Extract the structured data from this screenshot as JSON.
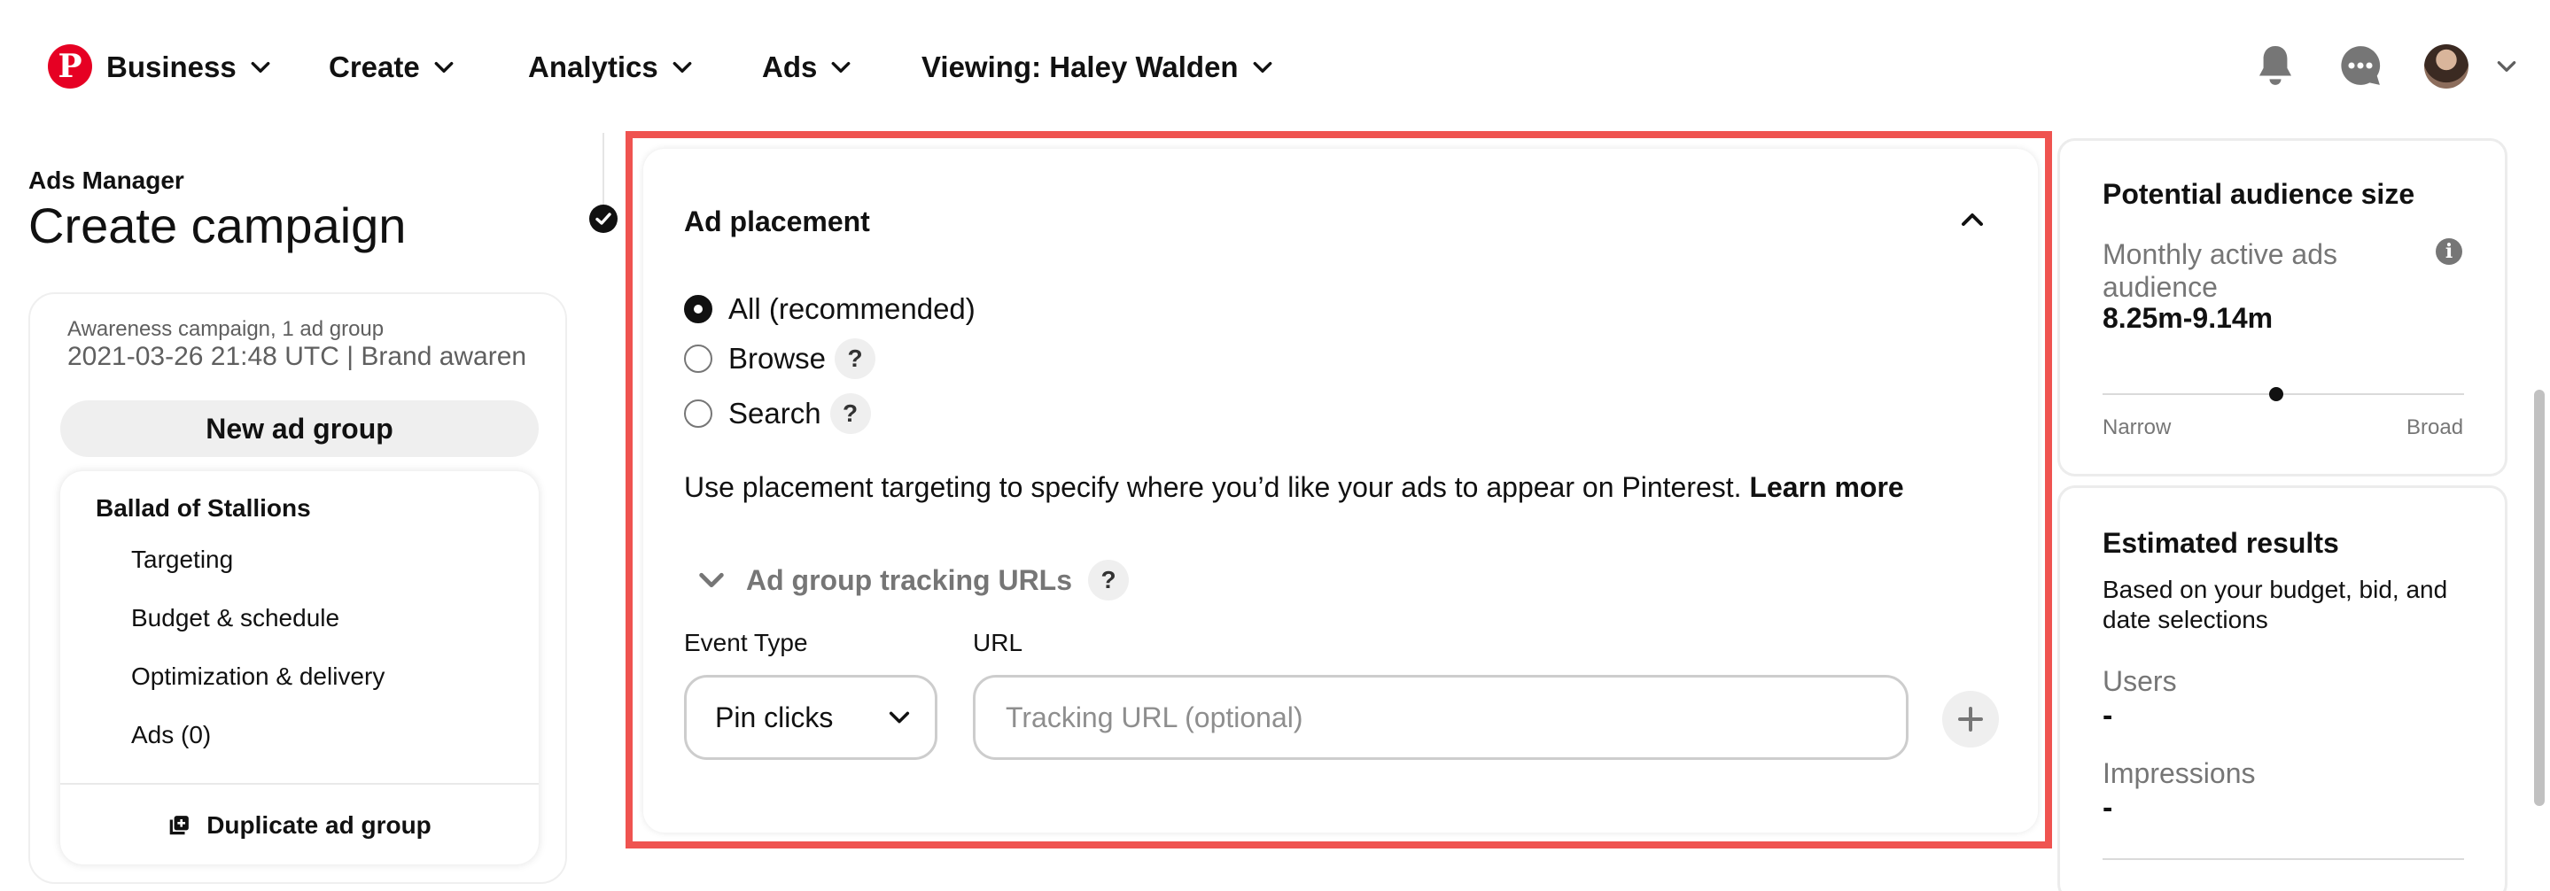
{
  "nav": {
    "logo_letter": "P",
    "business": "Business",
    "create": "Create",
    "analytics": "Analytics",
    "ads": "Ads",
    "viewing": "Viewing: Haley Walden"
  },
  "sidebar": {
    "eyebrow": "Ads Manager",
    "title": "Create campaign",
    "campaign_meta": "Awareness campaign, 1 ad group",
    "campaign_desc": "2021-03-26 21:48 UTC | Brand awaren...",
    "new_ad_group": "New ad group",
    "ad_group": {
      "name": "Ballad of Stallions",
      "links": [
        "Targeting",
        "Budget & schedule",
        "Optimization & delivery",
        "Ads (0)"
      ],
      "duplicate": "Duplicate ad group"
    }
  },
  "placement": {
    "title": "Ad placement",
    "options": [
      {
        "label": "All (recommended)",
        "selected": true
      },
      {
        "label": "Browse",
        "selected": false
      },
      {
        "label": "Search",
        "selected": false
      }
    ],
    "help_glyph": "?",
    "helper_text": "Use placement targeting to specify where you’d like your ads to appear on Pinterest.",
    "learn_more": "Learn more",
    "tracking_title": "Ad group tracking URLs",
    "event_type_label": "Event Type",
    "event_type_value": "Pin clicks",
    "url_label": "URL",
    "url_placeholder": "Tracking URL (optional)"
  },
  "audience": {
    "title": "Potential audience size",
    "metric_label": "Monthly active ads audience",
    "metric_value": "8.25m-9.14m",
    "info_glyph": "i",
    "slider_level": 0.48,
    "narrow": "Narrow",
    "broad": "Broad"
  },
  "estimates": {
    "title": "Estimated results",
    "subtitle": "Based on your budget, bid, and date selections",
    "users_label": "Users",
    "users_value": "-",
    "impressions_label": "Impressions",
    "impressions_value": "-"
  },
  "colors": {
    "brand_red": "#e60023",
    "highlight_red": "#ef5350",
    "muted_gray": "#767676"
  }
}
